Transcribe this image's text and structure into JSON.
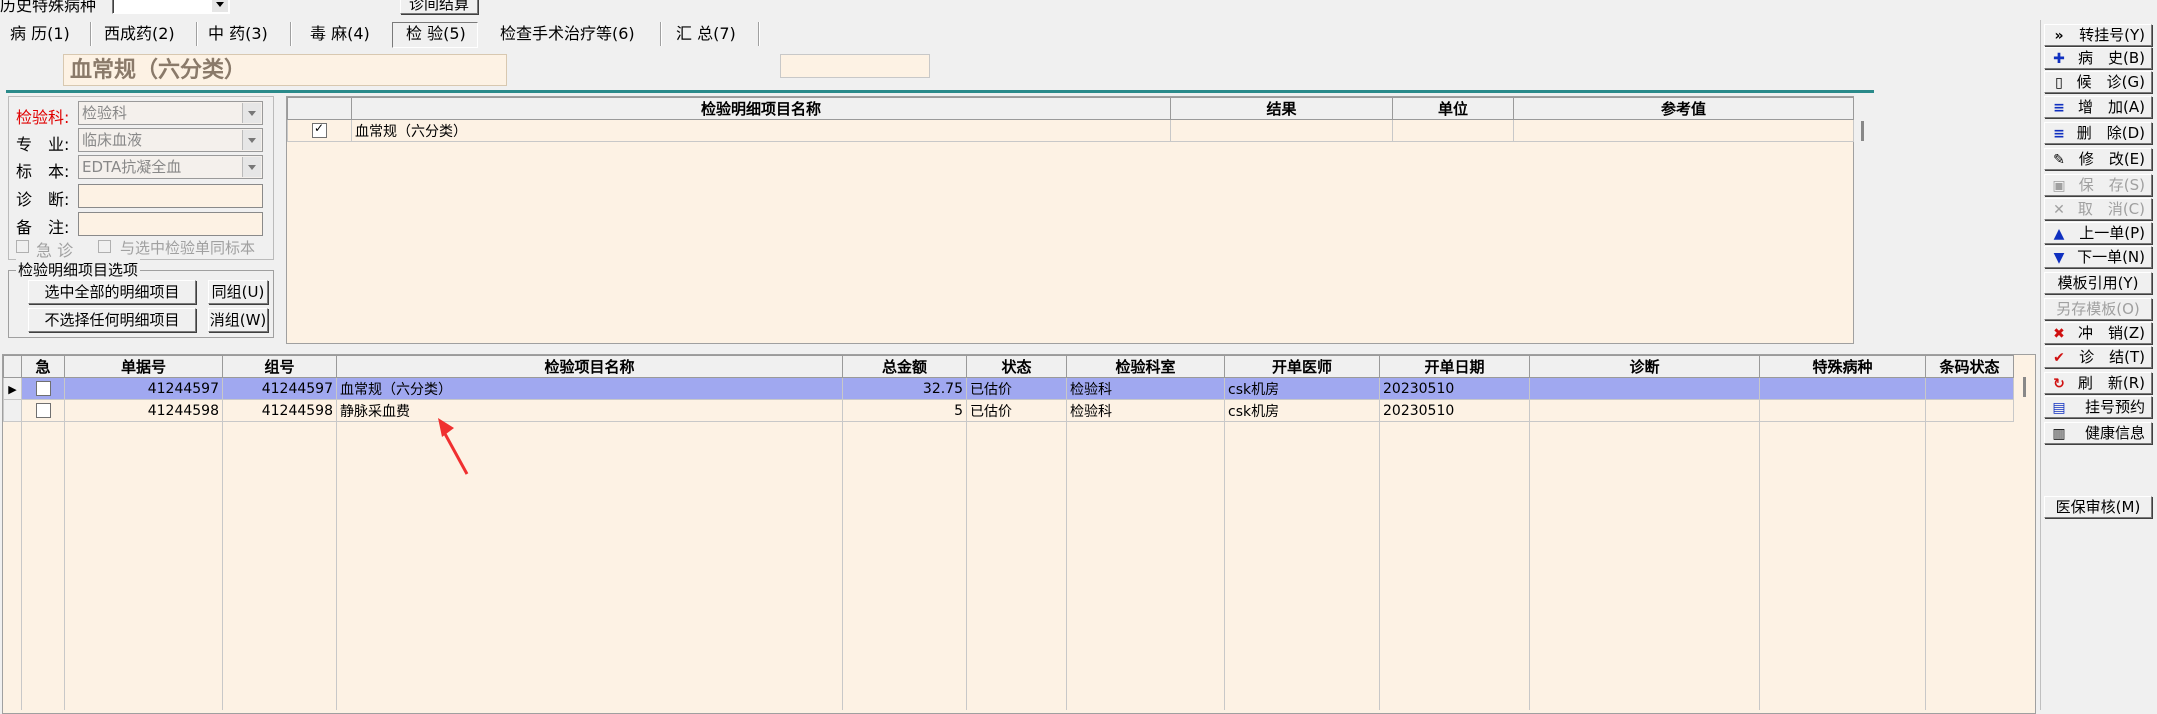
{
  "top": {
    "history_label": "历史特殊病种",
    "diagnosis_button": "诊间结算"
  },
  "tabs": [
    {
      "label": "病 历(1)",
      "active": false
    },
    {
      "label": "西成药(2)",
      "active": false
    },
    {
      "label": "中 药(3)",
      "active": false
    },
    {
      "label": "毒 麻(4)",
      "active": false
    },
    {
      "label": "检 验(5)",
      "active": true
    },
    {
      "label": "检查手术治疗等(6)",
      "active": false
    },
    {
      "label": "汇 总(7)",
      "active": false
    }
  ],
  "title_field": "血常规（六分类）",
  "form": {
    "dept_label": "检验科:",
    "dept_value": "检验科",
    "specialty_label": "专　业:",
    "specialty_value": "临床血液",
    "specimen_label": "标　本:",
    "specimen_value": "EDTA抗凝全血",
    "diagnosis_label": "诊　断:",
    "remark_label": "备　注:",
    "urgent_label": "急 诊",
    "same_specimen_label": "与选中检验单同标本"
  },
  "options_group": {
    "title": "检验明细项目选项",
    "select_all": "选中全部的明细项目",
    "select_none": "不选择任何明细项目",
    "same_group": "同组(U)",
    "cancel_group": "消组(W)"
  },
  "detail_table": {
    "headers": [
      "",
      "检验明细项目名称",
      "结果",
      "单位",
      "参考值"
    ],
    "rows": [
      {
        "checked": true,
        "name": "血常规（六分类）",
        "result": "",
        "unit": "",
        "ref": ""
      }
    ]
  },
  "main_table": {
    "headers": [
      "",
      "急",
      "单据号",
      "组号",
      "检验项目名称",
      "总金额",
      "状态",
      "检验科室",
      "开单医师",
      "开单日期",
      "诊断",
      "特殊病种",
      "条码状态"
    ],
    "rows": [
      {
        "selected": true,
        "doc": "41244597",
        "group": "41244597",
        "name": "血常规（六分类）",
        "amount": "32.75",
        "status": "已估价",
        "dept": "检验科",
        "doctor": "csk机房",
        "date": "20230510",
        "diag": "",
        "special": "",
        "barcode": ""
      },
      {
        "selected": false,
        "doc": "41244598",
        "group": "41244598",
        "name": "静脉采血费",
        "amount": "5",
        "status": "已估价",
        "dept": "检验科",
        "doctor": "csk机房",
        "date": "20230510",
        "diag": "",
        "special": "",
        "barcode": ""
      }
    ]
  },
  "right_buttons": [
    {
      "label": "转挂号(Y)",
      "icon": "double-chevron-right-icon",
      "glyph": "»",
      "color": "#000000",
      "enabled": true
    },
    {
      "label": "病　史(B)",
      "icon": "plus-icon",
      "glyph": "✚",
      "color": "#1030c0",
      "enabled": true
    },
    {
      "label": "候　诊(G)",
      "icon": "document-icon",
      "glyph": "▯",
      "color": "#000000",
      "enabled": true
    },
    {
      "label": "增　加(A)",
      "icon": "add-row-icon",
      "glyph": "≡",
      "color": "#1030c0",
      "enabled": true
    },
    {
      "label": "删　除(D)",
      "icon": "delete-row-icon",
      "glyph": "≡",
      "color": "#1030c0",
      "enabled": true
    },
    {
      "label": "修　改(E)",
      "icon": "edit-icon",
      "glyph": "✎",
      "color": "#000000",
      "enabled": true
    },
    {
      "label": "保　存(S)",
      "icon": "save-icon",
      "glyph": "▣",
      "color": "#a0a0a0",
      "enabled": false
    },
    {
      "label": "取　消(C)",
      "icon": "cancel-icon",
      "glyph": "✕",
      "color": "#a0a0a0",
      "enabled": false
    },
    {
      "label": "上一单(P)",
      "icon": "up-arrow-icon",
      "glyph": "▲",
      "color": "#1030c0",
      "enabled": true
    },
    {
      "label": "下一单(N)",
      "icon": "down-arrow-icon",
      "glyph": "▼",
      "color": "#1030c0",
      "enabled": true
    },
    {
      "label": "模板引用(Y)",
      "icon": "",
      "glyph": "",
      "color": "#000000",
      "enabled": true
    },
    {
      "label": "另存模板(O)",
      "icon": "",
      "glyph": "",
      "color": "#a0a0a0",
      "enabled": false
    },
    {
      "label": "冲　销(Z)",
      "icon": "red-x-icon",
      "glyph": "✖",
      "color": "#d01010",
      "enabled": true
    },
    {
      "label": "诊　结(T)",
      "icon": "checkmark-icon",
      "glyph": "✔",
      "color": "#d01010",
      "enabled": true
    },
    {
      "label": "刷　新(R)",
      "icon": "refresh-icon",
      "glyph": "↻",
      "color": "#d01010",
      "enabled": true
    },
    {
      "label": "挂号预约",
      "icon": "appointment-icon",
      "glyph": "▤",
      "color": "#1030c0",
      "enabled": true
    },
    {
      "label": "健康信息",
      "icon": "health-info-icon",
      "glyph": "▥",
      "color": "#000000",
      "enabled": true
    }
  ],
  "insurance_button": "医保审核(M)"
}
